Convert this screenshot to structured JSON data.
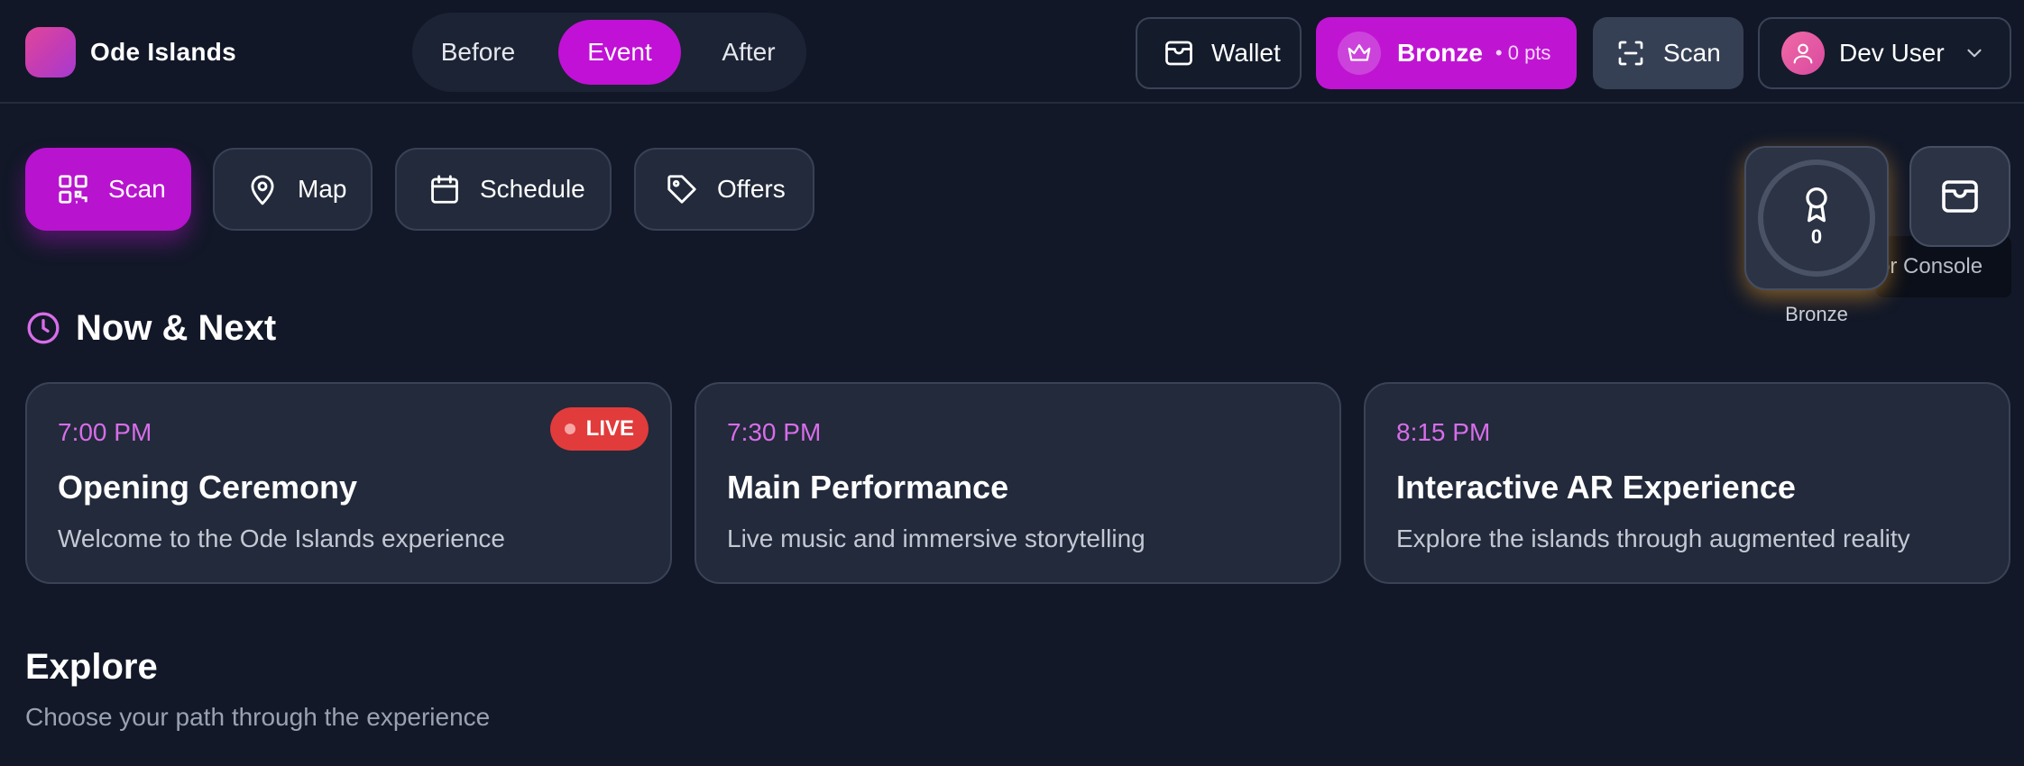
{
  "app": {
    "brand": "Ode Islands"
  },
  "header": {
    "phases": [
      "Before",
      "Event",
      "After"
    ],
    "active_phase": "Event",
    "wallet_label": "Wallet",
    "tier_label": "Bronze",
    "tier_points": "• 0 pts",
    "scan_label": "Scan",
    "user_name": "Dev User"
  },
  "actions": [
    {
      "label": "Scan",
      "icon": "qr-code-icon"
    },
    {
      "label": "Map",
      "icon": "map-pin-icon"
    },
    {
      "label": "Schedule",
      "icon": "calendar-icon"
    },
    {
      "label": "Offers",
      "icon": "tag-icon"
    }
  ],
  "floating": {
    "badge_count": "0",
    "badge_caption": "Bronze",
    "console_text": "or Console"
  },
  "now_next": {
    "title": "Now & Next",
    "items": [
      {
        "time": "7:00 PM",
        "title": "Opening Ceremony",
        "desc": "Welcome to the Ode Islands experience",
        "badge": "LIVE"
      },
      {
        "time": "7:30 PM",
        "title": "Main Performance",
        "desc": "Live music and immersive storytelling"
      },
      {
        "time": "8:15 PM",
        "title": "Interactive AR Experience",
        "desc": "Explore the islands through augmented reality"
      }
    ]
  },
  "explore": {
    "title": "Explore",
    "subtitle": "Choose your path through the experience"
  },
  "colors": {
    "accent": "#c111d6",
    "background": "#121828",
    "card": "#222a3b",
    "time_text": "#d86de9",
    "live": "#e23b3b"
  }
}
